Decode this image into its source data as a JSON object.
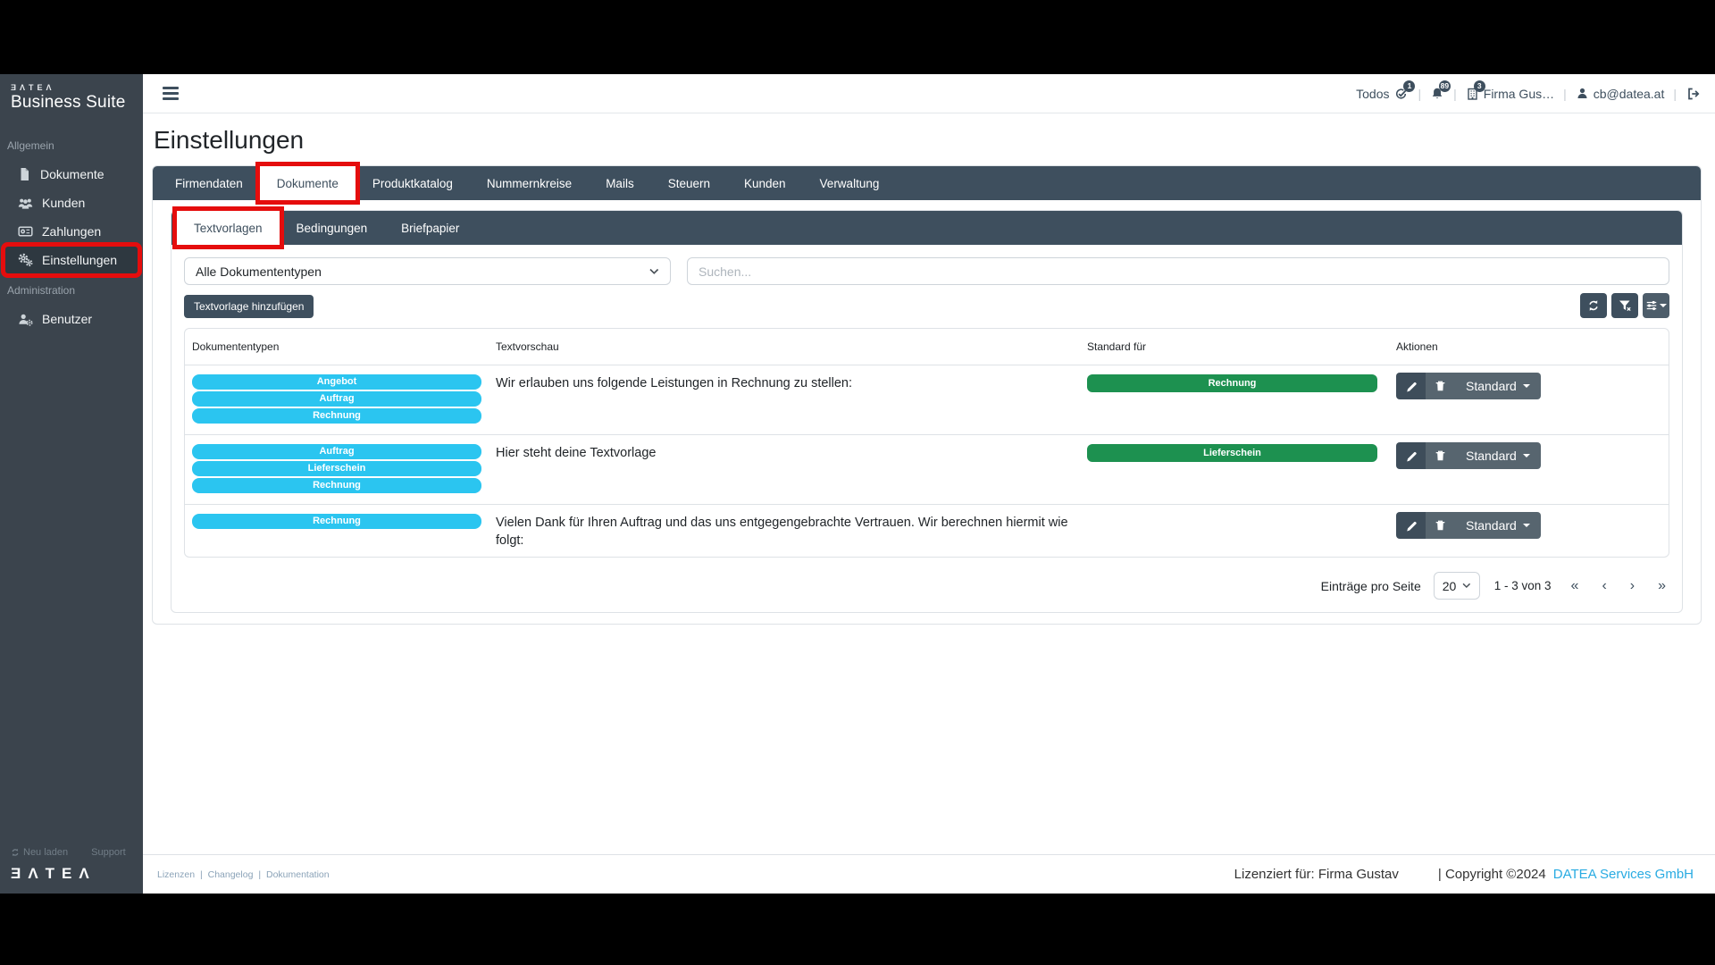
{
  "brand": {
    "wordmark": "ƎΛTEΛ",
    "product": "Business Suite",
    "footer_wordmark": "ƎΛTEΛ"
  },
  "sidebar": {
    "section1": "Allgemein",
    "items": [
      {
        "label": "Dokumente",
        "icon": "document-icon"
      },
      {
        "label": "Kunden",
        "icon": "users-icon"
      },
      {
        "label": "Zahlungen",
        "icon": "payments-icon"
      },
      {
        "label": "Einstellungen",
        "icon": "gears-icon"
      }
    ],
    "section2": "Administration",
    "admin_item": {
      "label": "Benutzer",
      "icon": "user-gear-icon"
    },
    "reload": "Neu laden",
    "support": "Support"
  },
  "topbar": {
    "sep": "|",
    "todos": "Todos",
    "todos_badge": "1",
    "notif_badge": "89",
    "company_badge": "3",
    "company": "Firma Gus…",
    "user": "cb@datea.at"
  },
  "page_title": "Einstellungen",
  "tabs": [
    {
      "label": "Firmendaten"
    },
    {
      "label": "Dokumente"
    },
    {
      "label": "Produktkatalog"
    },
    {
      "label": "Nummernkreise"
    },
    {
      "label": "Mails"
    },
    {
      "label": "Steuern"
    },
    {
      "label": "Kunden"
    },
    {
      "label": "Verwaltung"
    }
  ],
  "subtabs": [
    {
      "label": "Textvorlagen"
    },
    {
      "label": "Bedingungen"
    },
    {
      "label": "Briefpapier"
    }
  ],
  "filters": {
    "document_type": "Alle Dokumententypen",
    "search_placeholder": "Suchen..."
  },
  "toolbar": {
    "add_label": "Textvorlage hinzufügen"
  },
  "table": {
    "headers": [
      "Dokumententypen",
      "Textvorschau",
      "Standard für",
      "Aktionen"
    ],
    "rows": [
      {
        "types": [
          "Angebot",
          "Auftrag",
          "Rechnung"
        ],
        "preview": "Wir erlauben uns folgende Leistungen in Rechnung zu stellen:",
        "standard_for": "Rechnung",
        "dropdown": "Standard"
      },
      {
        "types": [
          "Auftrag",
          "Lieferschein",
          "Rechnung"
        ],
        "preview": "Hier steht deine Textvorlage",
        "standard_for": "Lieferschein",
        "dropdown": "Standard"
      },
      {
        "types": [
          "Rechnung"
        ],
        "preview": "Vielen Dank für Ihren Auftrag und das uns entgegengebrachte Vertrauen. Wir berechnen hiermit wie folgt:",
        "standard_for": "",
        "dropdown": "Standard"
      }
    ]
  },
  "pagination": {
    "per_page_label": "Einträge pro Seite",
    "per_page": "20",
    "range": "1 - 3 von 3",
    "first": "«",
    "prev": "‹",
    "next": "›",
    "last": "»"
  },
  "footer": {
    "links": [
      "Lizenzen",
      "Changelog",
      "Dokumentation"
    ],
    "sep": "|",
    "licensed_for": "Lizenziert für: Firma Gustav",
    "copyright": "| Copyright ©2024",
    "company_link": "DATEA Services GmbH"
  },
  "colors": {
    "sidebar": "#3b444d",
    "slate": "#3e4f5e",
    "pill_cyan": "#2bc5f0",
    "badge_green": "#1d9150",
    "annotation_red": "#e50d0d",
    "link_blue": "#29abe2"
  }
}
